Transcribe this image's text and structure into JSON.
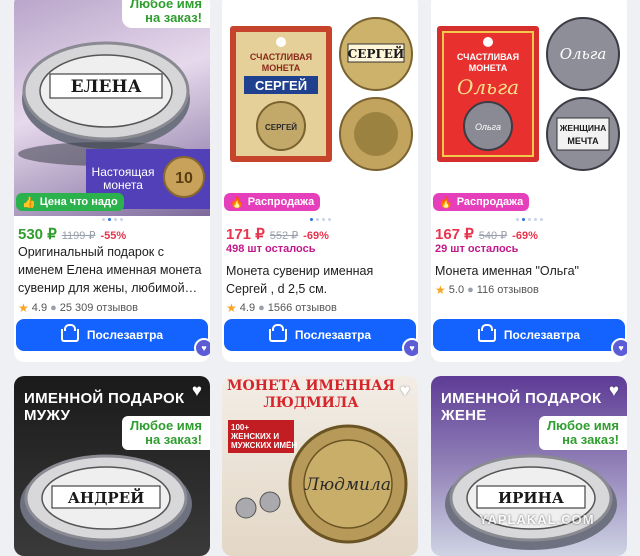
{
  "colors": {
    "accent": "#1463ff",
    "price_green": "#2f9e2f",
    "price_red": "#e8344e",
    "stock": "#c2188b",
    "sale_badge": "#e63fbb",
    "good_badge": "#2bb24c"
  },
  "products": [
    {
      "tag": "Любое имя\nна заказ!",
      "extra": "Настоящая\nмонета",
      "coin_text": "ЕЛЕНА",
      "badge": {
        "label": "Цена что надо",
        "icon": "thumbs-up-icon"
      },
      "price": "530 ₽",
      "old_price": "1199 ₽",
      "discount": "-55%",
      "title": "Оригинальный подарок с именем Елена именная монета сувенир для жены, любимой…",
      "rating": "4.9",
      "reviews": "25 309 отзывов",
      "button": "Послезавтра"
    },
    {
      "coin_text": "СЕРГЕЙ",
      "pack_label": "СЧАСТЛИВАЯ\nМОНЕТА",
      "badge": {
        "label": "Распродажа",
        "icon": "flame-icon"
      },
      "price": "171 ₽",
      "old_price": "552 ₽",
      "discount": "-69%",
      "stock": "498 шт осталось",
      "title": "Монета сувенир именная Сергей , d 2,5 см.",
      "rating": "4.9",
      "reviews": "1566 отзывов",
      "button": "Послезавтра"
    },
    {
      "coin_text": "Ольга",
      "pack_label": "СЧАСТЛИВАЯ\nМОНЕТА",
      "reverse_text": "ЖЕНЩИНА\nМЕЧТА",
      "badge": {
        "label": "Распродажа",
        "icon": "flame-icon"
      },
      "price": "167 ₽",
      "old_price": "540 ₽",
      "discount": "-69%",
      "stock": "29 шт осталось",
      "title": "Монета именная \"Ольга\"",
      "rating": "5.0",
      "reviews": "116 отзывов",
      "button": "Послезавтра"
    },
    {
      "banner": "ИМЕННОЙ ПОДАРОК\nМУЖУ",
      "tag": "Любое имя\nна заказ!",
      "coin_text": "АНДРЕЙ"
    },
    {
      "banner": "МОНЕТА ИМЕННАЯ\nЛЮДМИЛА",
      "extra": "100+\nЖЕНСКИХ И\nМУЖСКИХ ИМЁН",
      "coin_text": "Людмила"
    },
    {
      "banner": "ИМЕННОЙ ПОДАРОК\nЖЕНЕ",
      "tag": "Любое имя\nна заказ!",
      "coin_text": "ИРИНА"
    }
  ],
  "watermark": "YAPLAKAL.COM"
}
